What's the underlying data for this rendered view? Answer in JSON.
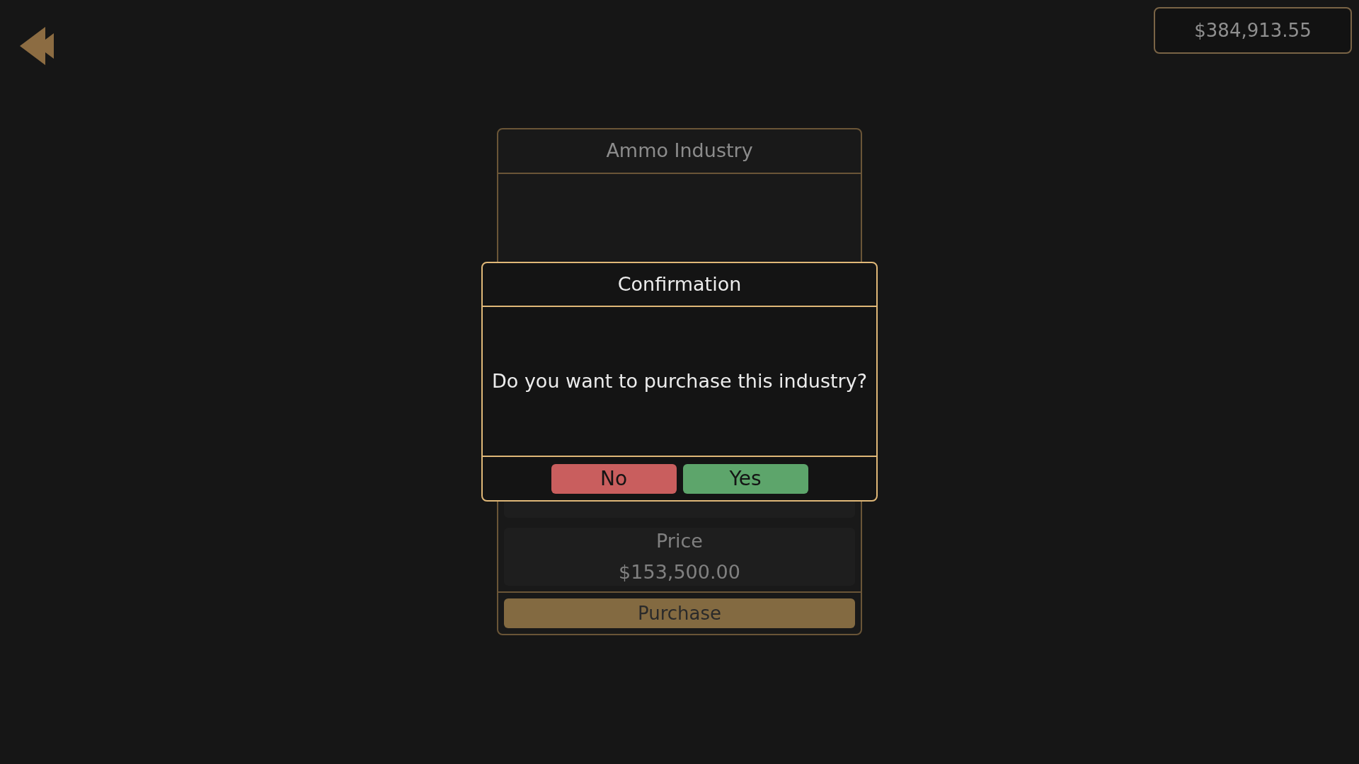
{
  "balance": "$384,913.55",
  "industry_panel": {
    "title": "Ammo Industry",
    "price_label": "Price",
    "price": "$153,500.00",
    "purchase_button": "Purchase"
  },
  "dialog": {
    "title": "Confirmation",
    "message": "Do you want to purchase this industry?",
    "buttons": [
      {
        "label": "No",
        "kind": "cancel"
      },
      {
        "label": "Yes",
        "kind": "confirm"
      }
    ]
  }
}
